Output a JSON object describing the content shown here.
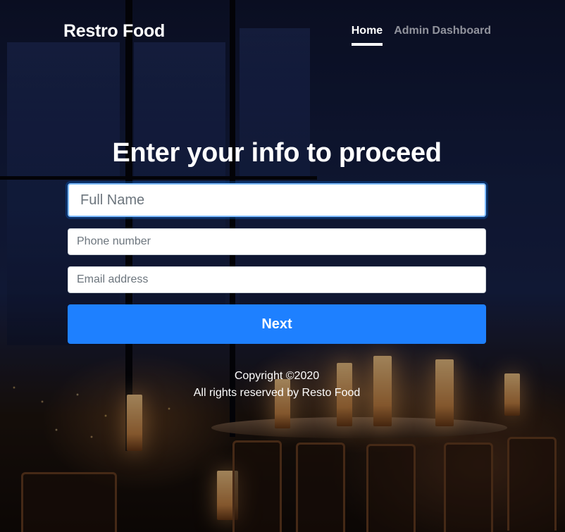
{
  "header": {
    "brand": "Restro Food",
    "nav": [
      {
        "label": "Home",
        "active": true
      },
      {
        "label": "Admin Dashboard",
        "active": false
      }
    ]
  },
  "form": {
    "heading": "Enter your info to proceed",
    "full_name": {
      "placeholder": "Full Name",
      "value": ""
    },
    "phone": {
      "placeholder": "Phone number",
      "value": ""
    },
    "email": {
      "placeholder": "Email address",
      "value": ""
    },
    "submit_label": "Next"
  },
  "footer": {
    "copyright": "Copyright ©2020",
    "rights": "All rights reserved by Resto Food"
  },
  "colors": {
    "primary_button": "#1e80ff",
    "text": "#ffffff",
    "focus_border": "#80bdff"
  }
}
